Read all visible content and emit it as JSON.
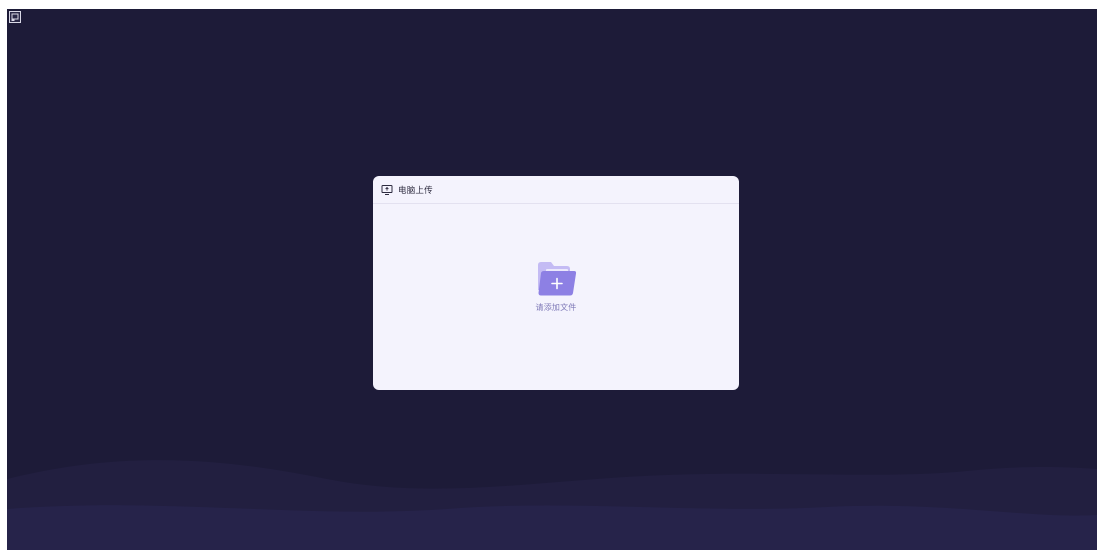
{
  "window": {
    "corner_icon": "image-icon"
  },
  "dialog": {
    "header": {
      "icon": "monitor-icon",
      "title": "电脑上传"
    },
    "drop_zone": {
      "icon": "folder-add-icon",
      "label": "请添加文件"
    }
  },
  "colors": {
    "background": "#1d1b38",
    "dialog_bg": "#f4f3fd",
    "accent": "#8b7fe8",
    "label": "#7f7ab8"
  }
}
